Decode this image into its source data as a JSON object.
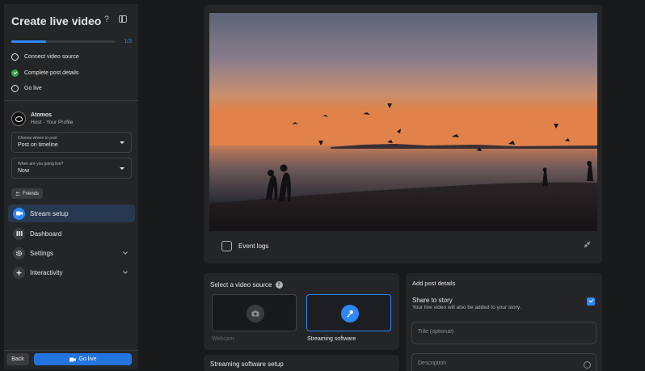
{
  "sidebar": {
    "title": "Create live video",
    "help_icon": "?",
    "progress_text": "1/3",
    "progress_fraction": 0.333,
    "steps": [
      {
        "label": "Connect video source",
        "done": false
      },
      {
        "label": "Complete post details",
        "done": true
      },
      {
        "label": "Go live",
        "done": false
      }
    ],
    "profile": {
      "name": "Atomos",
      "role": "Host - Your Profile"
    },
    "post_location": {
      "label": "Choose where to post",
      "value": "Post on timeline"
    },
    "schedule": {
      "label": "When are you going live?",
      "value": "Now"
    },
    "audience_chip": "Friends",
    "nav": [
      {
        "label": "Stream setup",
        "icon": "camera-icon",
        "active": true
      },
      {
        "label": "Dashboard",
        "icon": "dashboard-icon"
      },
      {
        "label": "Settings",
        "icon": "gear-icon"
      },
      {
        "label": "Interactivity",
        "icon": "sparkle-icon"
      }
    ],
    "back_label": "Back",
    "go_live_label": "Go live"
  },
  "preview": {
    "event_logs_label": "Event logs"
  },
  "video_source": {
    "title": "Select a video source",
    "options": [
      {
        "label": "Webcam",
        "icon": "camera-icon",
        "selected": false
      },
      {
        "label": "Streaming software",
        "icon": "key-icon",
        "selected": true
      }
    ]
  },
  "streaming_setup": {
    "title": "Streaming software setup"
  },
  "post_details": {
    "title": "Add post details",
    "share_story_title": "Share to story",
    "share_story_sub": "Your live video will also be added to your story.",
    "share_story_checked": true,
    "title_placeholder": "Title (optional)",
    "description_placeholder": "Description"
  },
  "colors": {
    "accent": "#2d88ff",
    "success": "#31a24c",
    "surface": "#242526",
    "background": "#18191a"
  }
}
